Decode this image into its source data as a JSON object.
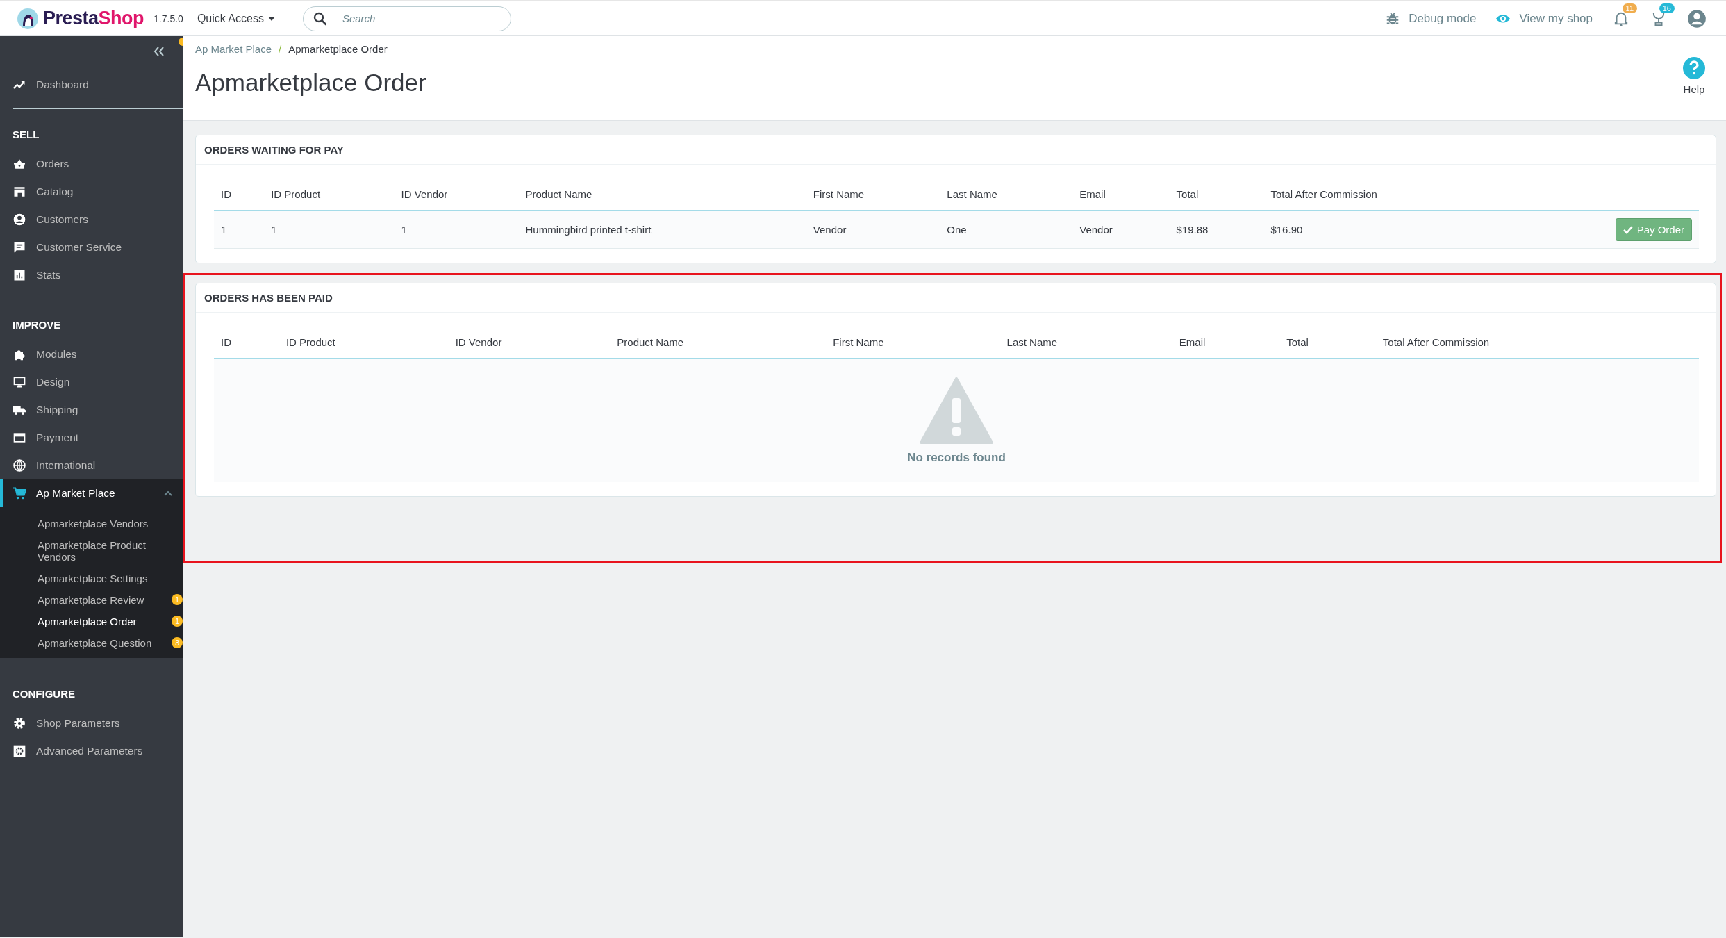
{
  "header": {
    "logo": [
      "Presta",
      "Shop"
    ],
    "version": "1.7.5.0",
    "quick_access": "Quick Access",
    "search": {
      "placeholder": "Search"
    },
    "debug_mode": "Debug mode",
    "view_shop": "View my shop",
    "notifications": "11",
    "orders_badge": "16"
  },
  "sidebar": {
    "sections": [
      {
        "items": [
          {
            "label": "Dashboard",
            "selected": false
          }
        ]
      },
      {
        "title": "SELL",
        "items": [
          {
            "label": "Orders",
            "selected": false
          },
          {
            "label": "Catalog",
            "selected": false
          },
          {
            "label": "Customers",
            "selected": false
          },
          {
            "label": "Customer Service",
            "selected": false
          },
          {
            "label": "Stats",
            "selected": false
          }
        ]
      },
      {
        "title": "IMPROVE",
        "items": [
          {
            "label": "Modules",
            "selected": false
          },
          {
            "label": "Design",
            "selected": false
          },
          {
            "label": "Shipping",
            "selected": false
          },
          {
            "label": "Payment",
            "selected": false
          },
          {
            "label": "International",
            "selected": false
          },
          {
            "label": "Ap Market Place",
            "selected": true,
            "expanded": true,
            "children": [
              {
                "label": "Apmarketplace Vendors",
                "selected": false
              },
              {
                "label": "Apmarketplace Product Vendors",
                "selected": false
              },
              {
                "label": "Apmarketplace Settings",
                "selected": false
              },
              {
                "label": "Apmarketplace Review",
                "selected": false,
                "badge": "1"
              },
              {
                "label": "Apmarketplace Order",
                "selected": true,
                "badge": "1"
              },
              {
                "label": "Apmarketplace Question",
                "selected": false,
                "badge": "3"
              }
            ]
          }
        ]
      },
      {
        "title": "CONFIGURE",
        "items": [
          {
            "label": "Shop Parameters",
            "selected": false
          },
          {
            "label": "Advanced Parameters",
            "selected": false
          }
        ]
      }
    ]
  },
  "breadcrumb": [
    "Ap Market Place",
    "Apmarketplace Order"
  ],
  "breadcrumb_separator": "/",
  "title": "Apmarketplace Order",
  "help": "Help",
  "panels": [
    {
      "title": "ORDERS WAITING FOR PAY",
      "highlighted": false,
      "columns": [
        "ID",
        "ID Product",
        "ID Vendor",
        "Product Name",
        "First Name",
        "Last Name",
        "Email",
        "Total",
        "Total After Commission"
      ],
      "rows": [
        {
          "cells": [
            "1",
            "1",
            "1",
            "Hummingbird printed t-shirt",
            "Vendor",
            "One",
            "Vendor",
            "$19.88",
            "$16.90"
          ],
          "action": "Pay Order"
        }
      ]
    },
    {
      "title": "ORDERS HAS BEEN PAID",
      "highlighted": true,
      "columns": [
        "ID",
        "ID Product",
        "ID Vendor",
        "Product Name",
        "First Name",
        "Last Name",
        "Email",
        "Total",
        "Total After Commission"
      ],
      "empty_message": "No records found"
    }
  ]
}
